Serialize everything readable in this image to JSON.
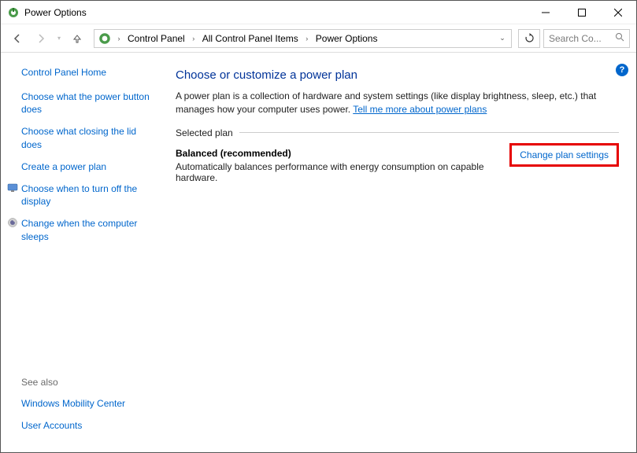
{
  "window": {
    "title": "Power Options"
  },
  "breadcrumb": {
    "items": [
      "Control Panel",
      "All Control Panel Items",
      "Power Options"
    ]
  },
  "search": {
    "placeholder": "Search Co..."
  },
  "sidebar": {
    "home": "Control Panel Home",
    "links": [
      {
        "label": "Choose what the power button does",
        "icon": null
      },
      {
        "label": "Choose what closing the lid does",
        "icon": null
      },
      {
        "label": "Create a power plan",
        "icon": null
      },
      {
        "label": "Choose when to turn off the display",
        "icon": "display-icon"
      },
      {
        "label": "Change when the computer sleeps",
        "icon": "sleep-icon"
      }
    ],
    "see_also_label": "See also",
    "see_also": [
      {
        "label": "Windows Mobility Center"
      },
      {
        "label": "User Accounts"
      }
    ]
  },
  "main": {
    "heading": "Choose or customize a power plan",
    "description": "A power plan is a collection of hardware and system settings (like display brightness, sleep, etc.) that manages how your computer uses power. ",
    "more_link": "Tell me more about power plans",
    "section_label": "Selected plan",
    "plan": {
      "name": "Balanced (recommended)",
      "desc": "Automatically balances performance with energy consumption on capable hardware."
    },
    "change_link": "Change plan settings"
  },
  "help": "?"
}
